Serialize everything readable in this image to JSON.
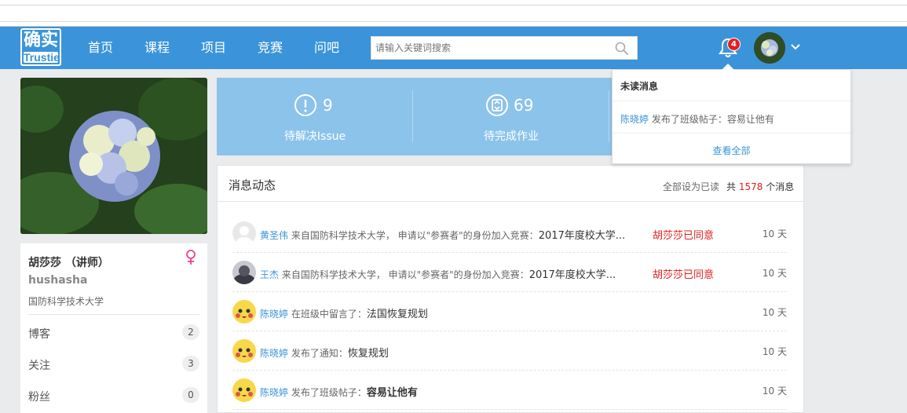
{
  "nav": {
    "logo_cn": "确实",
    "logo_en": "Trustie",
    "items": [
      "首页",
      "课程",
      "项目",
      "竞赛",
      "问吧"
    ],
    "search_placeholder": "请输入关键词搜索",
    "notification_count": "4"
  },
  "dropdown": {
    "title": "未读消息",
    "message_user": "陈晓婷",
    "message_text": " 发布了班级帖子：容易让他有",
    "view_all": "查看全部"
  },
  "profile": {
    "name": "胡莎莎 （讲师）",
    "login": "hushasha",
    "org": "国防科学技术大学",
    "rows": [
      {
        "label": "博客",
        "count": "2"
      },
      {
        "label": "关注",
        "count": "3"
      },
      {
        "label": "粉丝",
        "count": "0"
      }
    ]
  },
  "stats": [
    {
      "value": "9",
      "label": "待解决Issue"
    },
    {
      "value": "69",
      "label": "待完成作业"
    }
  ],
  "feed": {
    "title": "消息动态",
    "mark_read": "全部设为已读",
    "total_prefix": "共 ",
    "total": "1578",
    "total_suffix": " 个消息",
    "rows": [
      {
        "user": "黄圣伟",
        "text": " 来自国防科学技术大学， 申请以\"参赛者\"的身份加入竞赛：",
        "target": "2017年度校大学...",
        "status": "胡莎莎已同意",
        "time": "10 天"
      },
      {
        "user": "王杰",
        "text": " 来自国防科学技术大学， 申请以\"参赛者\"的身份加入竞赛：",
        "target": "2017年度校大学...",
        "status": "胡莎莎已同意",
        "time": "10 天"
      },
      {
        "user": "陈晓婷",
        "text": " 在班级中留言了：",
        "target": "法国恢复规划",
        "status": "",
        "time": "10 天"
      },
      {
        "user": "陈晓婷",
        "text": " 发布了通知：",
        "target": "恢复规划",
        "status": "",
        "time": "10 天"
      },
      {
        "user": "陈晓婷",
        "text": " 发布了班级帖子：",
        "target": "容易让他有",
        "status": "",
        "time": "10 天"
      }
    ]
  },
  "colors": {
    "nav_bg": "#3b94d9",
    "stats_bg": "#8cc3ea",
    "status_red": "#e02020",
    "link_blue": "#3b94d9"
  }
}
